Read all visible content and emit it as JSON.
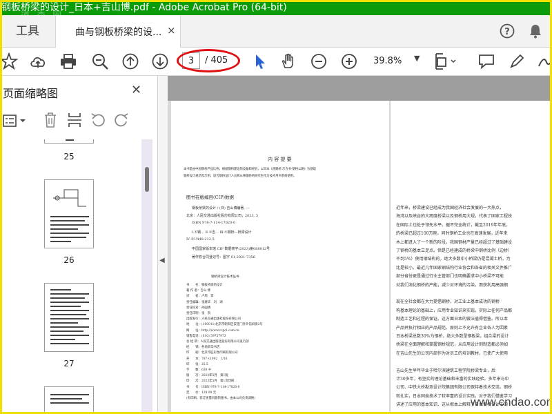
{
  "window": {
    "title": "钢板桥梁的设计_日本+吉山博.pdf - Adobe Acrobat Pro (64-bit)"
  },
  "tabs": {
    "tools_label": "工具",
    "doc_label": "曲与钢板桥梁的设...",
    "close_glyph": "×"
  },
  "toolbar": {
    "current_page": "3",
    "total_pages": "/ 405",
    "zoom": "39.8%"
  },
  "sidebar": {
    "title": "页面缩略图",
    "close_glyph": "✕",
    "thumbnails": [
      "25",
      "26",
      "27"
    ]
  },
  "document_left": {
    "heading": "内 容 提 要",
    "summary": [
      "本书是由中国钢桥产品比例，根据钢桥建设的设备和经验，以日本《道路桥 示方书·钢桥公路》为基础",
      "钢桥设计规范及示例，适合钢桥设计人员和从事钢桥的研究生作为技术用书参阅使用。"
    ],
    "cip_title": "图书在版编目(CIP)数据",
    "cip_lines": [
      "钢板桥梁的设计 / (日) 吉山博编著. —",
      "北京：人民交通出版社股份有限公司，2023. 5",
      "ISBN 978-7-114-17820-0",
      "Ⅰ.①钢… Ⅱ.①吉… Ⅲ.①钢桥—桥梁设计",
      "Ⅳ.①U448.212.5",
      "中国国家版本馆 CIP 数据核字(2023)第088912号",
      "著作权合同登记号：图字 01-2021-7356"
    ],
    "colophon_title": "钢桥梁设计技术丛书",
    "colophon_lines": [
      "书　　名：钢板桥梁的设计",
      "著 作 者：吉山 博",
      "译　　者：卢周　等",
      "责任编辑：张建华　刘　湖",
      "责任校对：孙国靖",
      "责任印制：张　凯",
      "出版发行：人民交通出版社股份有限公司",
      "地　　址：(100011)北京市朝阳区安定门外外馆斜街3号",
      "网　　址：http://www.ccpcl.com.cn",
      "销售电话：(010) 59757973",
      "总 经 销：人民交通出版社股份有限公司发行部",
      "经　　销：各地新华书店",
      "印　　刷：北京印匠彩色印刷有限公司",
      "开　　本：787×1092　1/16",
      "印　　张：25.5",
      "字　　数：630 千",
      "版　　次：2023年5月　第1版",
      "印　　次：2023年5月　第1次印刷",
      "书　　号：ISBN 978-7-114-17820-0",
      "定　　价：128.00 元",
      "(有印刷、装订质量问题的图书，由本公司负责调换)"
    ]
  },
  "document_right": {
    "lines": [
      "近年来，桥梁建设已经成为我国经济社会发展的一大热点，",
      "海湾以及峡谷的大跨度桥梁以及钢桥用大规，代表了国家工程技",
      "在国际上也处于领先水平。据不完全统计，截至2019年年底，",
      "的桥梁已超过100万座。同时钢桥工业也在高速发展，近年来",
      "木上都进入了一个新的阶段，我国钢材产量已经超过了基础建设",
      "了钢桥的基本立足点。但是已经建成的桥梁中钢桥比例（边桥）",
      "不到5%）使用钢结构的，绝大多数中小桥梁仍是混凝土桥，为",
      "比是较小。最近几年国家钢结构行业协会和各省的相关文件推广",
      "部分省份更是通过行业主管部门也明确要求中小桥梁不可能",
      "对我们消化钢桥的产能，减少对环境的污染，而获利用高强钢",
      "",
      "现在全社会都在大力提倡钢桥，对工业上基本成功的钢桥",
      "构基本理论的基础上，应用专业知识来实现。实际上任何产品都",
      "制造工艺和过程的保证。这方面日本的做法值得借鉴。所以本",
      "产品并执行相应的产品规范，原则上不允许有企业各人为因素",
      "日本桥梁总数30%为钢桥，绝大多数是钢板梁，组合梁的设计",
      "桥梁在全面理解和掌握钢桥规范，从应用设计到制造都必须如",
      "在吉山先生的公司内部作为对员工的培训教材，已使广大使用",
      "",
      "吉山先生早年毕业于哈尔滨建筑工程学院桥梁专业，后",
      "计30多年，有坚实的理论基础和丰富的实践经验。多年来与中",
      "公司、中铁大桥勘测设计院集团有限公司保持着技术交流。钢桥",
      "较扎实，日本同类技术了较丰富的设计实践，对于我们借鉴学习",
      "讲述了应用的基本知识、这从根本上解释了日本钢桥设计中的"
    ]
  },
  "watermarks": {
    "bottom_right": "www.cndao.com",
    "top_left": "道 森 网"
  }
}
